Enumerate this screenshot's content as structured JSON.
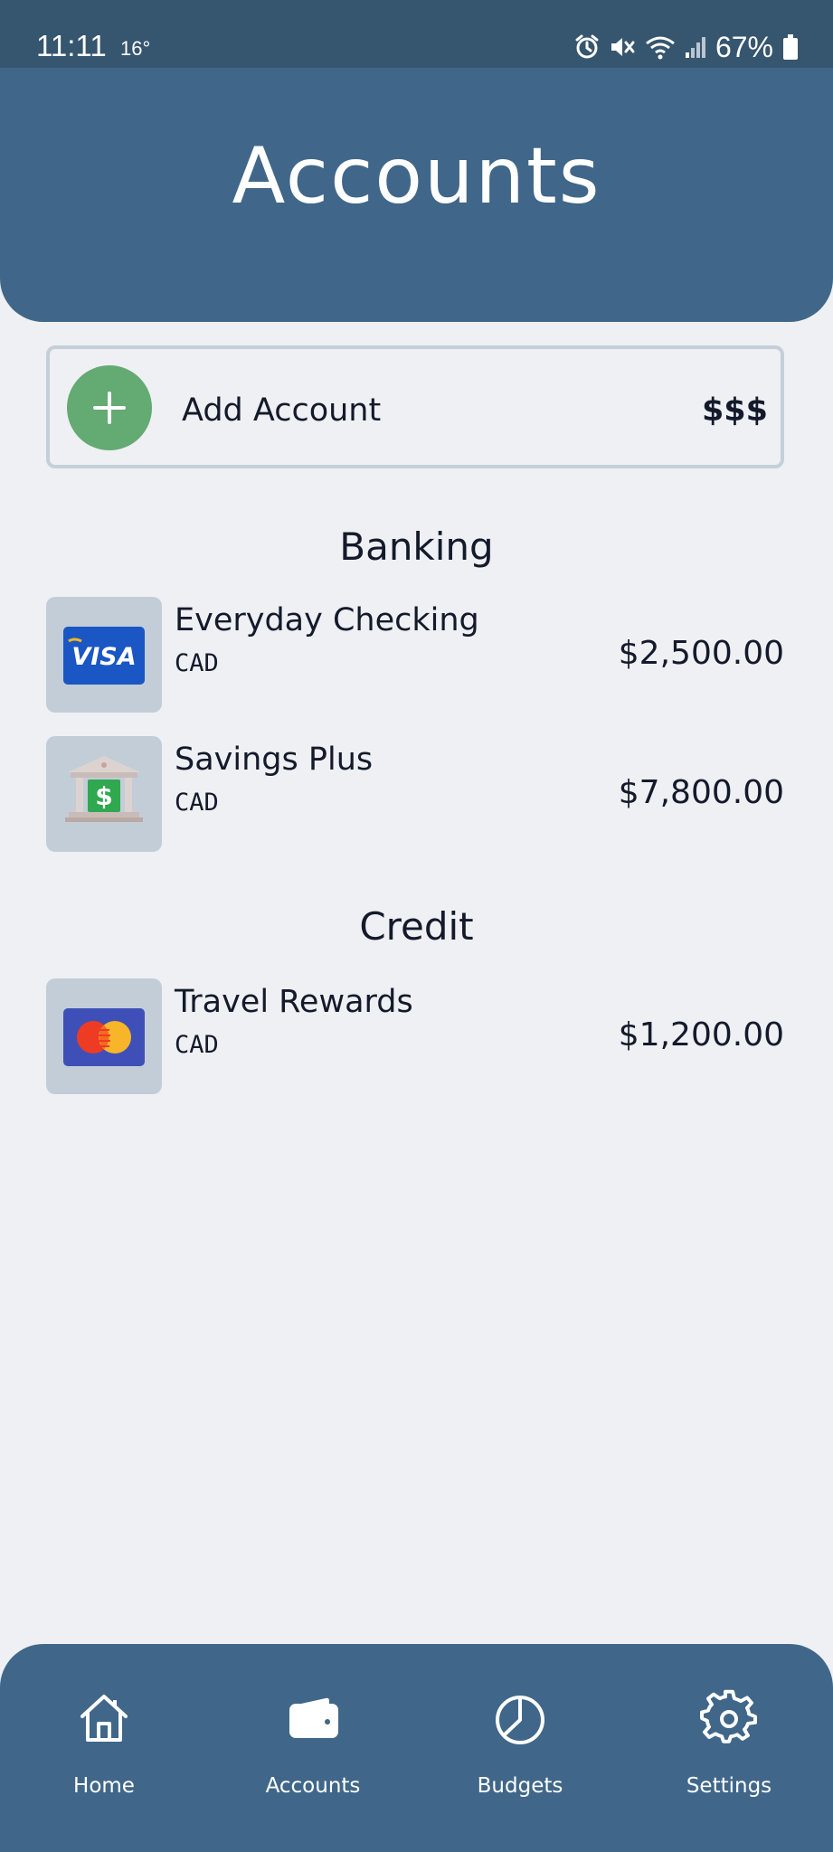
{
  "status_bar": {
    "time": "11:11",
    "temperature": "16°",
    "battery": "67%",
    "icons": [
      "alarm-icon",
      "mute-icon",
      "wifi-icon",
      "signal-icon",
      "battery-icon"
    ]
  },
  "header": {
    "title": "Accounts"
  },
  "add_account": {
    "label": "Add Account",
    "amount": "$$$",
    "icon": "plus-icon"
  },
  "sections": [
    {
      "heading": "Banking",
      "accounts": [
        {
          "name": "Everyday Checking",
          "currency": "CAD",
          "balance": "$2,500.00",
          "icon": "visa-card-icon"
        },
        {
          "name": "Savings Plus",
          "currency": "CAD",
          "balance": "$7,800.00",
          "icon": "bank-icon"
        }
      ]
    },
    {
      "heading": "Credit",
      "accounts": [
        {
          "name": "Travel Rewards",
          "currency": "CAD",
          "balance": "$1,200.00",
          "icon": "mastercard-icon"
        }
      ]
    }
  ],
  "nav": {
    "items": [
      {
        "label": "Home",
        "icon": "home-icon"
      },
      {
        "label": "Accounts",
        "icon": "wallet-icon"
      },
      {
        "label": "Budgets",
        "icon": "pie-chart-icon"
      },
      {
        "label": "Settings",
        "icon": "gear-icon"
      }
    ]
  },
  "colors": {
    "header_bg": "#406789",
    "status_bar_bg": "#36556f",
    "page_bg": "#eef0f3",
    "tile_bg": "#c3cdd8",
    "add_button": "#63aa73",
    "text": "#141a2b"
  }
}
